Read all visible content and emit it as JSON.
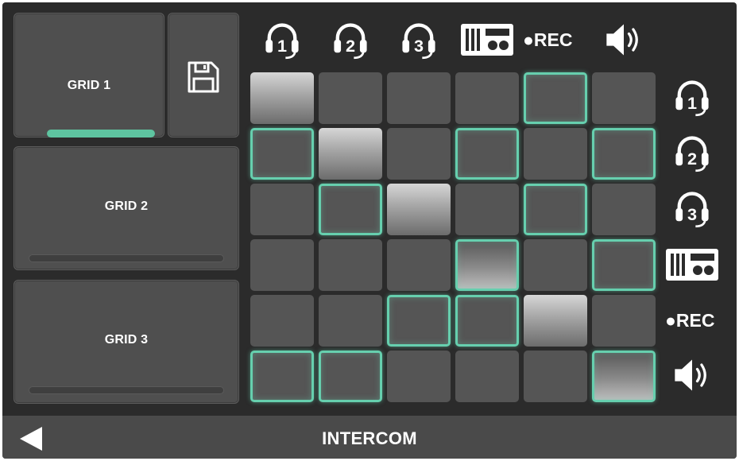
{
  "grids": [
    {
      "label": "GRID 1",
      "progress": 1.0,
      "selected": true
    },
    {
      "label": "GRID 2",
      "progress": 0.0,
      "selected": false
    },
    {
      "label": "GRID 3",
      "progress": 0.0,
      "selected": false
    }
  ],
  "save": {
    "icon": "floppy-disk-icon"
  },
  "channels": [
    {
      "icon": "headset-icon",
      "number": "1"
    },
    {
      "icon": "headset-icon",
      "number": "2"
    },
    {
      "icon": "headset-icon",
      "number": "3"
    },
    {
      "icon": "radio-icon",
      "number": ""
    },
    {
      "icon": "record-dot-icon",
      "text": "●REC"
    },
    {
      "icon": "speaker-icon",
      "number": ""
    }
  ],
  "matrix": [
    [
      "diag",
      "off",
      "off",
      "off",
      "on",
      "off"
    ],
    [
      "on",
      "diag",
      "off",
      "on",
      "off",
      "on"
    ],
    [
      "off",
      "on",
      "diag",
      "off",
      "on",
      "off"
    ],
    [
      "off",
      "off",
      "off",
      "on-diag",
      "off",
      "on"
    ],
    [
      "off",
      "off",
      "on",
      "on",
      "diag",
      "off"
    ],
    [
      "on",
      "on",
      "off",
      "off",
      "off",
      "on-diag"
    ]
  ],
  "footer": {
    "title": "INTERCOM",
    "back_icon": "back-arrow-icon"
  },
  "colors": {
    "accent": "#66cfae",
    "progress": "#5ec4a0",
    "cell": "#555555",
    "panel": "#4f4f4f",
    "background": "#2b2b2b",
    "footer": "#4a4a4a"
  }
}
